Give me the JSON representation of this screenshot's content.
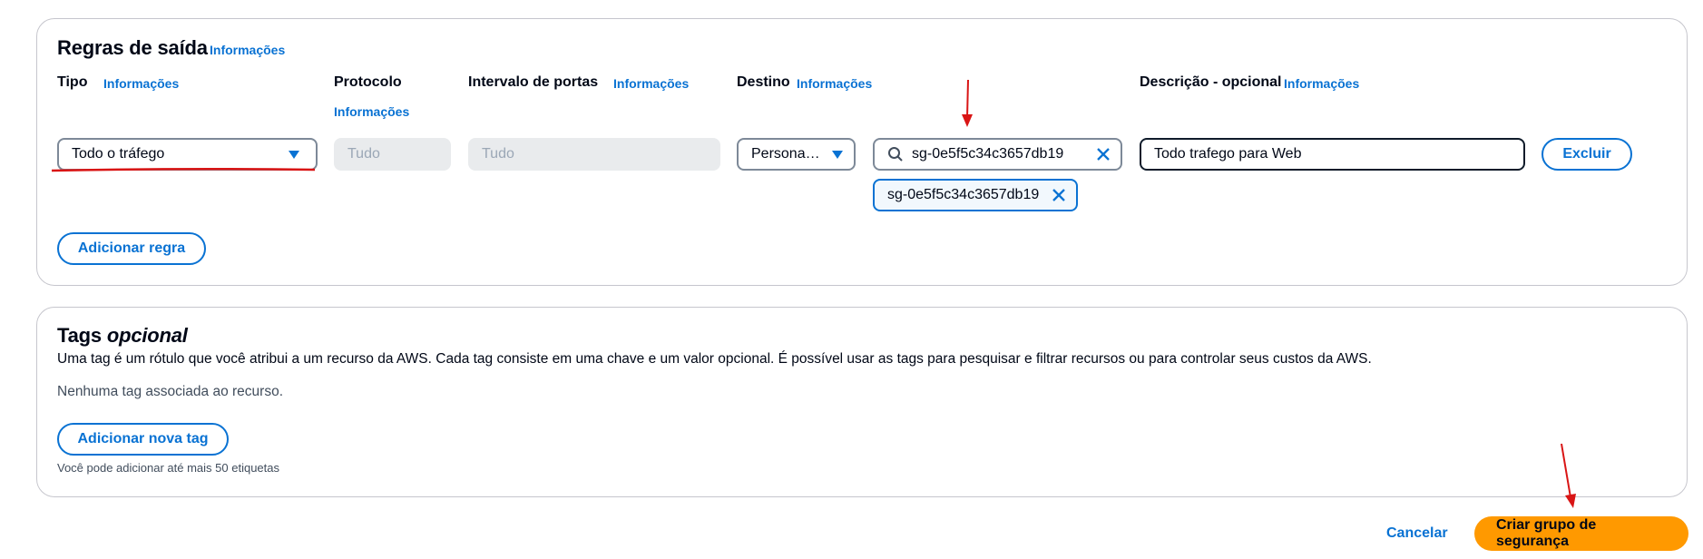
{
  "outbound": {
    "title": "Regras de saída",
    "title_info": "Informações",
    "columns": {
      "type": "Tipo",
      "type_info": "Informações",
      "protocol": "Protocolo",
      "protocol_info": "Informações",
      "port_range": "Intervalo de portas",
      "port_range_info": "Informações",
      "destination": "Destino",
      "destination_info": "Informações",
      "description": "Descrição - opcional",
      "description_info": "Informações"
    },
    "rule": {
      "type_value": "Todo o tráfego",
      "protocol_value": "Tudo",
      "port_value": "Tudo",
      "destination_value": "Persona…",
      "search_value": "sg-0e5f5c34c3657db19",
      "selected_token": "sg-0e5f5c34c3657db19",
      "description_value": "Todo trafego para Web",
      "delete_label": "Excluir"
    },
    "add_rule_label": "Adicionar regra"
  },
  "tags": {
    "title_main": "Tags",
    "title_optional": "opcional",
    "description": "Uma tag é um rótulo que você atribui a um recurso da AWS. Cada tag consiste em uma chave e um valor opcional. É possível usar as tags para pesquisar e filtrar recursos ou para controlar seus custos da AWS.",
    "empty_text": "Nenhuma tag associada ao recurso.",
    "add_tag_label": "Adicionar nova tag",
    "limit_text": "Você pode adicionar até mais 50 etiquetas"
  },
  "footer": {
    "cancel_label": "Cancelar",
    "create_label": "Criar grupo de segurança"
  },
  "colors": {
    "link": "#0972d3",
    "primary_button": "#ff9900",
    "annotation": "#d91515"
  }
}
